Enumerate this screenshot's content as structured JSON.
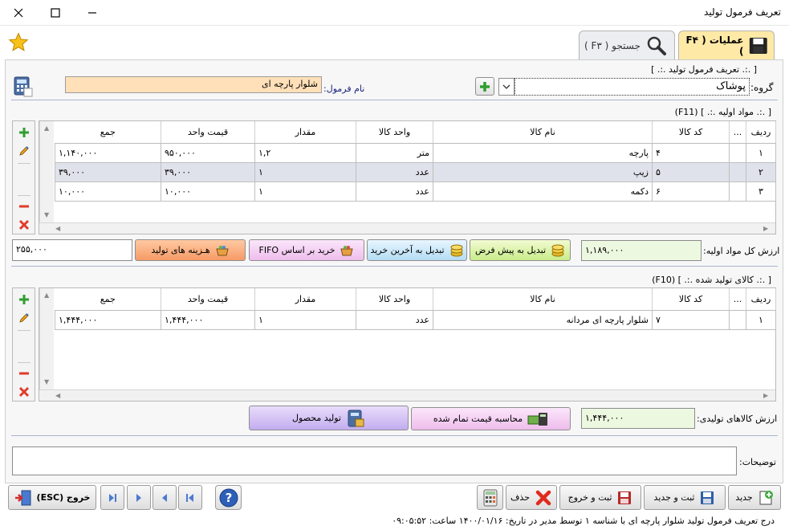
{
  "window": {
    "title": "تعریف فرمول تولید"
  },
  "tabs": {
    "operations": "عملیات ( F۴ )",
    "search": "جستجو ( F۳ )"
  },
  "header": {
    "section_title": "[ .:. تعریف فرمول تولید .:. ]",
    "group_label": "گروه:",
    "group_value": "پوشاک",
    "formula_name_label": "نام فرمول:",
    "formula_name_value": "شلوار پارچه ای"
  },
  "raw_materials": {
    "title": "[ .:. مواد اولیه .:. ] (F11)",
    "columns": [
      "ردیف",
      "...",
      "کد کالا",
      "نام کالا",
      "واحد کالا",
      "مقدار",
      "قیمت واحد",
      "جمع"
    ],
    "rows": [
      {
        "row": "۱",
        "code": "۴",
        "name": "پارچه",
        "unit": "متر",
        "qty": "۱,۲",
        "price": "۹۵۰,۰۰۰",
        "total": "۱,۱۴۰,۰۰۰"
      },
      {
        "row": "۲",
        "code": "۵",
        "name": "زیپ",
        "unit": "عدد",
        "qty": "۱",
        "price": "۳۹,۰۰۰",
        "total": "۳۹,۰۰۰"
      },
      {
        "row": "۳",
        "code": "۶",
        "name": "دکمه",
        "unit": "عدد",
        "qty": "۱",
        "price": "۱۰,۰۰۰",
        "total": "۱۰,۰۰۰"
      }
    ],
    "total_label": "ارزش کل مواد اولیه:",
    "total_value": "۱,۱۸۹,۰۰۰",
    "btn_default": "تبدیل به پیش فرض",
    "btn_last_purchase": "تبدیل به آخرین خرید",
    "btn_fifo": "خرید بر اساس   FIFO",
    "btn_costs": "هـزینه های تولید",
    "costs_value": "۲۵۵,۰۰۰"
  },
  "products": {
    "title": "[ .:. کالای تولید شده .:. ] (F10)",
    "columns": [
      "ردیف",
      "...",
      "کد کالا",
      "نام کالا",
      "واحد کالا",
      "مقدار",
      "قیمت واحد",
      "جمع"
    ],
    "rows": [
      {
        "row": "۱",
        "code": "۷",
        "name": "شلوار پارچه ای مردانه",
        "unit": "عدد",
        "qty": "۱",
        "price": "۱,۴۴۴,۰۰۰",
        "total": "۱,۴۴۴,۰۰۰"
      }
    ],
    "total_label": "ارزش کالاهای تولیدی:",
    "total_value": "۱,۴۴۴,۰۰۰",
    "btn_calc": "محاسبه قیمت تمام شده",
    "btn_produce": "تولید محصول"
  },
  "notes": {
    "label": "توضیحات:",
    "value": ""
  },
  "toolbar": {
    "new": "جدید",
    "save_new": "ثبت و جدید",
    "save_exit": "ثبت و خروج",
    "delete": "حذف",
    "exit": "خروج (ESC)"
  },
  "status": "درج  تعریف فرمول تولید شلوار پارچه ای با شناسه ۱ توسط مدیر در تاریخ: ۱۴۰۰/۰۱/۱۶ ساعت: ۰۹:۰۵:۵۲",
  "colors": {
    "tab_active": "#ffe9a6",
    "costs_btn": "#f69a66",
    "input_highlight": "#ffe0b8",
    "total_box": "#ecf8e0"
  }
}
